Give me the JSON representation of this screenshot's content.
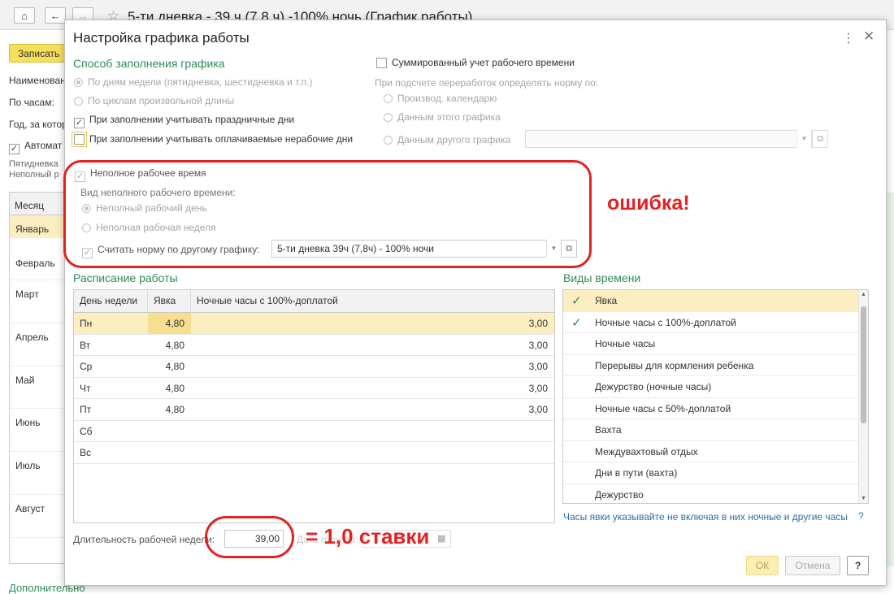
{
  "main_window": {
    "title": "5-ти дневка - 39 ч (7,8 ч) -100% ночь (График работы)",
    "save_label": "Записать",
    "labels": [
      "Наименован",
      "По часам:",
      "Год, за котор",
      "Автомат"
    ],
    "small_lines": [
      "Пятидневка",
      "Неполный р"
    ],
    "month_header": "Месяц",
    "months": [
      "Январь",
      "Февраль",
      "Март",
      "Апрель",
      "Май",
      "Июнь",
      "Июль",
      "Август"
    ],
    "footer_link": "Дополнительно"
  },
  "dialog": {
    "title": "Настройка графика работы",
    "fill_method": {
      "title": "Способ заполнения графика",
      "by_weekdays": "По дням недели (пятидневка, шестидневка и т.п.)",
      "by_cycles": "По циклам произвольной длины",
      "holidays": "При заполнении учитывать праздничные дни",
      "paid_nonworking": "При заполнении учитывать оплачиваемые нерабочие дни"
    },
    "summed": {
      "label": "Суммированный учет рабочего времени",
      "overtime_note": "При подсчете переработок определять норму по:",
      "opt_calendar": "Производ. календарю",
      "opt_this": "Данным этого графика",
      "opt_other": "Данным другого графика"
    },
    "part_time": {
      "label": "Неполное рабочее время",
      "kind_label": "Вид неполного рабочего времени:",
      "opt_day": "Неполный рабочий день",
      "opt_week": "Неполная рабочая неделя",
      "norm_label": "Считать норму по другому графику:",
      "norm_value": "5-ти дневка 39ч (7,8ч) - 100% ночи"
    },
    "schedule": {
      "title": "Расписание работы",
      "columns": [
        "День недели",
        "Явка",
        "Ночные часы с 100%-доплатой"
      ],
      "rows": [
        {
          "day": "Пн",
          "yavka": "4,80",
          "night": "3,00"
        },
        {
          "day": "Вт",
          "yavka": "4,80",
          "night": "3,00"
        },
        {
          "day": "Ср",
          "yavka": "4,80",
          "night": "3,00"
        },
        {
          "day": "Чт",
          "yavka": "4,80",
          "night": "3,00"
        },
        {
          "day": "Пт",
          "yavka": "4,80",
          "night": "3,00"
        },
        {
          "day": "Сб",
          "yavka": "",
          "night": ""
        },
        {
          "day": "Вс",
          "yavka": "",
          "night": ""
        }
      ]
    },
    "time_types": {
      "title": "Виды времени",
      "items": [
        {
          "label": "Явка",
          "checked": true
        },
        {
          "label": "Ночные часы с 100%-доплатой",
          "checked": true
        },
        {
          "label": "Ночные часы",
          "checked": false
        },
        {
          "label": "Перерывы для кормления ребенка",
          "checked": false
        },
        {
          "label": "Дежурство (ночные часы)",
          "checked": false
        },
        {
          "label": "Ночные часы с 50%-доплатой",
          "checked": false
        },
        {
          "label": "Вахта",
          "checked": false
        },
        {
          "label": "Междувахтовый отдых",
          "checked": false
        },
        {
          "label": "Дни в пути (вахта)",
          "checked": false
        },
        {
          "label": "Дежурство",
          "checked": false
        }
      ],
      "hint": "Часы явки указывайте не включая в них ночные и другие часы",
      "help": "?"
    },
    "week_length": {
      "label": "Длительность рабочей недели:",
      "value": "39,00",
      "hidden_label": "Дата отсчета"
    },
    "buttons": {
      "ok": "ОК",
      "cancel": "Отмена",
      "help": "?"
    }
  },
  "annotations": {
    "error": "ошибка!",
    "rate": "= 1,0 ставки",
    "color": "#e32222"
  }
}
